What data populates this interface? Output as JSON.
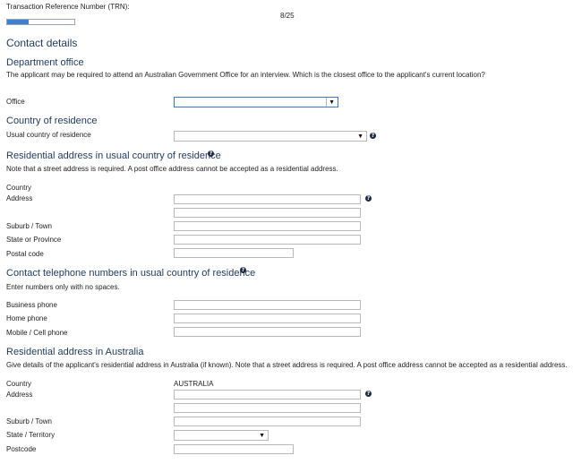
{
  "header": {
    "trn_label": "Transaction Reference Number (TRN):",
    "page_indicator": "8/25",
    "progress": 0.32
  },
  "contact_details": {
    "title": "Contact details"
  },
  "department_office": {
    "title": "Department office",
    "description": "The applicant may be required to attend an Australian Government Office for an interview. Which is the closest office to the applicant's current location?",
    "office_label": "Office",
    "office_value": ""
  },
  "country_of_residence": {
    "title": "Country of residence",
    "usual_country_label": "Usual country of residence",
    "usual_country_value": ""
  },
  "residential_address_usual": {
    "title": "Residential address in usual country of residence",
    "note": "Note that a street address is required. A post office address cannot be accepted as a residential address.",
    "country_label": "Country",
    "address_label": "Address",
    "suburb_label": "Suburb / Town",
    "state_label": "State or Province",
    "postal_label": "Postal code"
  },
  "contact_phones": {
    "title": "Contact telephone numbers in usual country of residence",
    "note": "Enter numbers only with no spaces.",
    "business_label": "Business phone",
    "home_label": "Home phone",
    "mobile_label": "Mobile / Cell phone"
  },
  "residential_address_australia": {
    "title": "Residential address in Australia",
    "note": "Give details of the applicant's residential address in Australia (if known). Note that a street address is required. A post office address cannot be accepted as a residential address.",
    "country_label": "Country",
    "country_value": "AUSTRALIA",
    "address_label": "Address",
    "suburb_label": "Suburb / Town",
    "state_label": "State / Territory",
    "postcode_label": "Postcode"
  },
  "icons": {
    "help": "?",
    "dropdown": "▼"
  }
}
